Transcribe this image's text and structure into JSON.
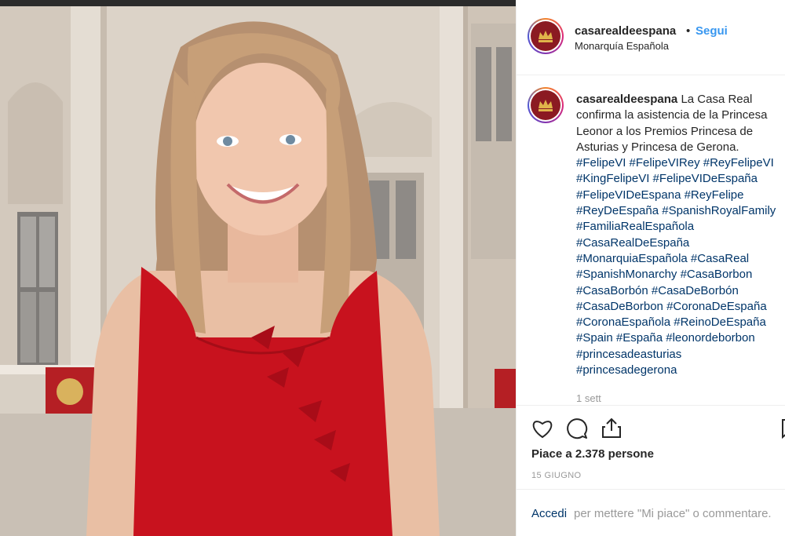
{
  "post": {
    "username": "casarealdeespana",
    "follow_label": "Segui",
    "separator": "•",
    "location": "Monarquía Española",
    "caption_text": "La Casa Real",
    "caption_lines": [
      "confirma la asistencia de la Princesa",
      "Leonor a los Premios Princesa de",
      "Asturias y Princesa de Gerona."
    ],
    "hashtag_lines": [
      "#FelipeVI #FelipeVIRey #ReyFelipeVI",
      "#KingFelipeVI #FelipeVIDeEspaña",
      "#FelipeVIDeEspana #ReyFelipe",
      "#ReyDeEspaña #SpanishRoyalFamily",
      "#FamiliaRealEspañola",
      "#CasaRealDeEspaña",
      "#MonarquiaEspañola #CasaReal",
      "#SpanishMonarchy #CasaBorbon",
      "#CasaBorbón #CasaDeBorbón",
      "#CasaDeBorbon #CoronaDeEspaña",
      "#CoronaEspañola #ReinoDeEspaña",
      "#Spain #España #leonordeborbon",
      "#princesadeasturias",
      "#princesadegerona"
    ],
    "time_ago": "1 sett",
    "likes_text": "Piace a 2.378 persone",
    "date": "15 GIUGNO",
    "login_link": "Accedi",
    "login_rest": "per mettere \"Mi piace\" o commentare."
  },
  "icons": {
    "like": "heart-icon",
    "comment": "comment-icon",
    "share": "share-icon",
    "save": "bookmark-icon",
    "avatar_emblem": "crown-icon"
  },
  "colors": {
    "link": "#003569",
    "follow": "#3897f0",
    "muted": "#999999",
    "dress": "#c8121e"
  }
}
